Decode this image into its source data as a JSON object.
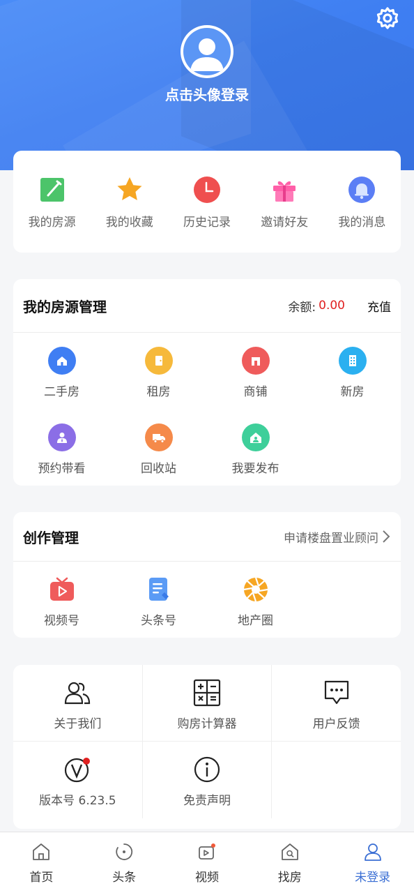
{
  "header": {
    "login_text": "点击头像登录"
  },
  "quick": {
    "items": [
      {
        "label": "我的房源",
        "icon": "edit-icon"
      },
      {
        "label": "我的收藏",
        "icon": "star-icon"
      },
      {
        "label": "历史记录",
        "icon": "clock-icon"
      },
      {
        "label": "邀请好友",
        "icon": "gift-icon"
      },
      {
        "label": "我的消息",
        "icon": "bell-icon"
      }
    ]
  },
  "property": {
    "title": "我的房源管理",
    "balance_label": "余额:",
    "balance_value": "0.00",
    "recharge": "充值",
    "items": [
      {
        "label": "二手房",
        "icon": "house-icon",
        "color": "#3f7ef3"
      },
      {
        "label": "租房",
        "icon": "door-icon",
        "color": "#f6b93b"
      },
      {
        "label": "商铺",
        "icon": "shop-icon",
        "color": "#ef5b5b"
      },
      {
        "label": "新房",
        "icon": "building-icon",
        "color": "#2bb0f0"
      },
      {
        "label": "预约带看",
        "icon": "agent-icon",
        "color": "#8b6ee6"
      },
      {
        "label": "回收站",
        "icon": "truck-icon",
        "color": "#f58a4a"
      },
      {
        "label": "我要发布",
        "icon": "publish-icon",
        "color": "#3ecf9a"
      }
    ]
  },
  "creation": {
    "title": "创作管理",
    "link": "申请楼盘置业顾问",
    "items": [
      {
        "label": "视频号",
        "icon": "tv-icon"
      },
      {
        "label": "头条号",
        "icon": "document-icon"
      },
      {
        "label": "地产圈",
        "icon": "aperture-icon"
      }
    ]
  },
  "tools": {
    "items": [
      {
        "label": "关于我们",
        "icon": "users-icon"
      },
      {
        "label": "购房计算器",
        "icon": "calculator-icon"
      },
      {
        "label": "用户反馈",
        "icon": "chat-icon"
      },
      {
        "label": "版本号 6.23.5",
        "icon": "version-icon"
      },
      {
        "label": "免责声明",
        "icon": "info-icon"
      }
    ]
  },
  "tabbar": {
    "tabs": [
      {
        "label": "首页",
        "icon": "home-icon"
      },
      {
        "label": "头条",
        "icon": "headline-icon"
      },
      {
        "label": "视频",
        "icon": "video-icon"
      },
      {
        "label": "找房",
        "icon": "find-house-icon"
      },
      {
        "label": "未登录",
        "icon": "user-icon",
        "active": true
      }
    ]
  },
  "colors": {
    "primary": "#3f7ff2",
    "balance": "#e02020",
    "active_tab": "#3b6fd4"
  }
}
